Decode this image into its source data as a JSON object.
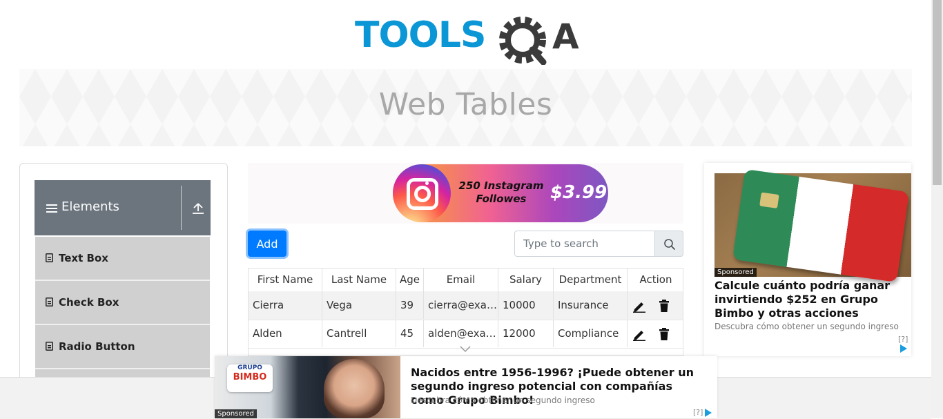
{
  "logo": {
    "text_main": "TOOLS",
    "text_q": "Q",
    "text_a": "A",
    "brand_blue": "#0b96d6",
    "brand_dark": "#3b3b3b"
  },
  "page": {
    "title": "Web Tables"
  },
  "sidebar": {
    "group_label": "Elements",
    "menu_icon": "hamburger-icon",
    "collapse_icon": "upload-arrow-icon",
    "items": [
      {
        "label": "Text Box",
        "icon": "document-icon"
      },
      {
        "label": "Check Box",
        "icon": "document-icon"
      },
      {
        "label": "Radio Button",
        "icon": "document-icon"
      }
    ]
  },
  "promo": {
    "line1": "250 Instagram",
    "line2": "Followes",
    "price": "$3.99"
  },
  "toolbar": {
    "add_label": "Add",
    "search_placeholder": "Type to search",
    "search_icon": "magnifier-icon"
  },
  "table": {
    "columns": [
      "First Name",
      "Last Name",
      "Age",
      "Email",
      "Salary",
      "Department",
      "Action"
    ],
    "rows": [
      {
        "first": "Cierra",
        "last": "Vega",
        "age": "39",
        "email": "cierra@example.com",
        "salary": "10000",
        "department": "Insurance"
      },
      {
        "first": "Alden",
        "last": "Cantrell",
        "age": "45",
        "email": "alden@example.com",
        "salary": "12000",
        "department": "Compliance"
      }
    ],
    "action_icons": [
      "pencil-icon",
      "trash-icon"
    ]
  },
  "right_ad": {
    "sponsored": "Sponsored",
    "headline": "Calcule cuánto podría ganar invirtiendo $252 en Grupo Bimbo y otras acciones",
    "description": "Descubra cómo obtener un segundo ingreso",
    "adchoices": "[?]"
  },
  "bottom_ad": {
    "sponsored": "Sponsored",
    "brand_line1": "GRUPO",
    "brand_line2": "BIMBO",
    "headline": "Nacidos entre 1956-1996? ¡Puede obtener un segundo ingreso potencial con compañías como Grupo Bimbo!",
    "description": "Descubra cómo obtener un segundo ingreso",
    "adchoices": "[?]"
  },
  "colors": {
    "primary": "#007bff",
    "sidebar_header": "#6c757d",
    "sidebar_item": "#d0d0d0"
  }
}
